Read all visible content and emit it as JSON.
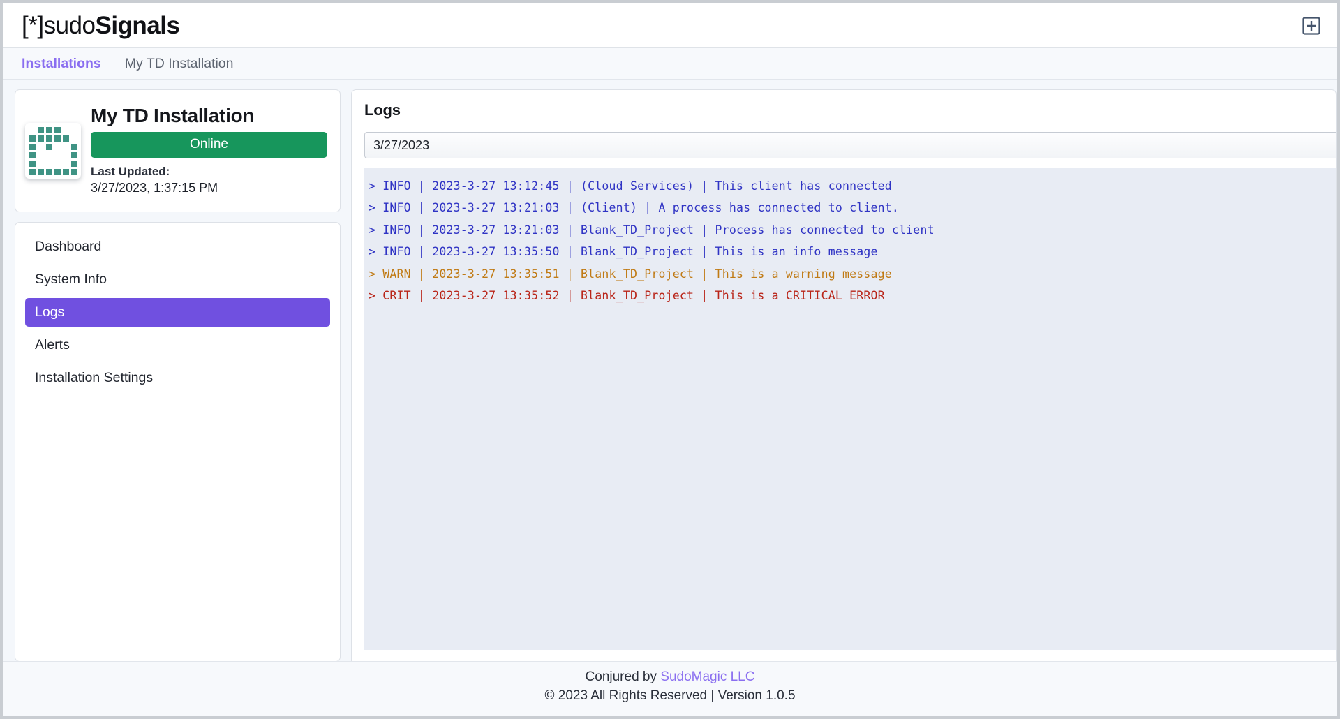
{
  "header": {
    "logo_bracket_left": "[*]",
    "logo_sudo": "sudo",
    "logo_signals": "Signals",
    "add_icon": "add-square-icon"
  },
  "breadcrumb": {
    "items": [
      {
        "label": "Installations",
        "active": true
      },
      {
        "label": "My TD Installation",
        "active": false
      }
    ]
  },
  "installation": {
    "icon": "touchdesigner-logo-icon",
    "name": "My TD Installation",
    "status": "Online",
    "status_color": "#17965c",
    "last_updated_label": "Last Updated:",
    "last_updated_value": "3/27/2023, 1:37:15 PM"
  },
  "sidebar": {
    "items": [
      {
        "label": "Dashboard",
        "active": false
      },
      {
        "label": "System Info",
        "active": false
      },
      {
        "label": "Logs",
        "active": true
      },
      {
        "label": "Alerts",
        "active": false
      },
      {
        "label": "Installation Settings",
        "active": false
      }
    ],
    "active_color": "#7050e0"
  },
  "logs_panel": {
    "title": "Logs",
    "date_filter_value": "3/27/2023",
    "background_color": "#e8ecf4",
    "level_colors": {
      "info": "#2f33c4",
      "warn": "#c07a14",
      "crit": "#b92418"
    },
    "entries": [
      {
        "level": "INFO",
        "timestamp": "2023-3-27 13:12:45",
        "source": "(Cloud Services)",
        "message": "This client has connected",
        "text": "> INFO | 2023-3-27 13:12:45 | (Cloud Services) | This client has connected"
      },
      {
        "level": "INFO",
        "timestamp": "2023-3-27 13:21:03",
        "source": "(Client)",
        "message": "A process has connected to client.",
        "text": "> INFO | 2023-3-27 13:21:03 | (Client) | A process has connected to client."
      },
      {
        "level": "INFO",
        "timestamp": "2023-3-27 13:21:03",
        "source": "Blank_TD_Project",
        "message": "Process has connected to client",
        "text": "> INFO | 2023-3-27 13:21:03 | Blank_TD_Project | Process has connected to client"
      },
      {
        "level": "INFO",
        "timestamp": "2023-3-27 13:35:50",
        "source": "Blank_TD_Project",
        "message": "This is an info message",
        "text": "> INFO | 2023-3-27 13:35:50 | Blank_TD_Project | This is an info message"
      },
      {
        "level": "WARN",
        "timestamp": "2023-3-27 13:35:51",
        "source": "Blank_TD_Project",
        "message": "This is a warning message",
        "text": "> WARN | 2023-3-27 13:35:51 | Blank_TD_Project | This is a warning message"
      },
      {
        "level": "CRIT",
        "timestamp": "2023-3-27 13:35:52",
        "source": "Blank_TD_Project",
        "message": "This is a CRITICAL ERROR",
        "text": "> CRIT | 2023-3-27 13:35:52 | Blank_TD_Project | This is a CRITICAL ERROR"
      }
    ]
  },
  "footer": {
    "conjured_prefix": "Conjured by ",
    "company": "SudoMagic LLC",
    "copyright": "© 2023 All Rights Reserved | Version 1.0.5"
  }
}
